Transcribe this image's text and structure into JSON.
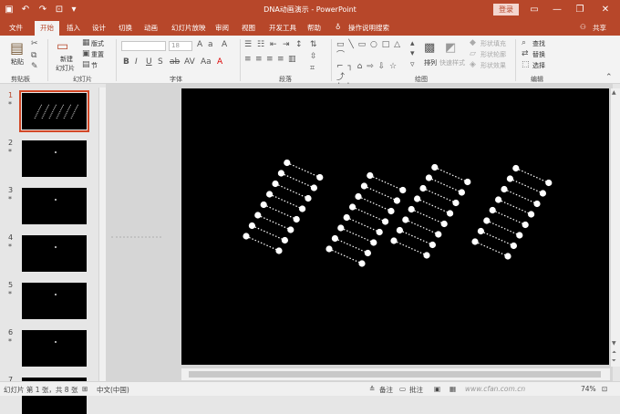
{
  "window": {
    "title": "DNA动画演示 - PowerPoint",
    "login_label": "登录",
    "share_label": "共享"
  },
  "tabs": [
    {
      "label": "文件"
    },
    {
      "label": "开始"
    },
    {
      "label": "插入"
    },
    {
      "label": "设计"
    },
    {
      "label": "切换"
    },
    {
      "label": "动画"
    },
    {
      "label": "幻灯片放映"
    },
    {
      "label": "审阅"
    },
    {
      "label": "视图"
    },
    {
      "label": "开发工具"
    },
    {
      "label": "帮助"
    },
    {
      "label": "操作说明搜索"
    }
  ],
  "ribbon": {
    "clipboard": {
      "paste": "粘贴",
      "group": "剪贴板"
    },
    "slides": {
      "new_slide_1": "新建",
      "new_slide_2": "幻灯片",
      "layout": "版式",
      "reset": "重置",
      "section": "节",
      "group": "幻灯片"
    },
    "font": {
      "size": "18",
      "group": "字体"
    },
    "paragraph": {
      "group": "段落"
    },
    "drawing": {
      "arrange": "排列",
      "quick_styles": "快速样式",
      "shape_fill": "形状填充",
      "shape_outline": "形状轮廓",
      "shape_effects": "形状效果",
      "group": "绘图"
    },
    "editing": {
      "find": "查找",
      "replace": "替换",
      "select": "选择",
      "group": "编辑"
    }
  },
  "slides": [
    {
      "num": "1",
      "star": "*"
    },
    {
      "num": "2",
      "star": "*"
    },
    {
      "num": "3",
      "star": "*"
    },
    {
      "num": "4",
      "star": "*"
    },
    {
      "num": "5",
      "star": "*"
    },
    {
      "num": "6",
      "star": "*"
    },
    {
      "num": "7"
    }
  ],
  "status": {
    "slide_info": "幻灯片 第 1 张，共 8 张",
    "language": "中文(中国)",
    "notes": "备注",
    "comments": "批注",
    "zoom": "74%",
    "watermark": "www.cfan.com.cn"
  },
  "slide_content": {
    "helix_count": 4,
    "rungs_per_helix": 8
  }
}
